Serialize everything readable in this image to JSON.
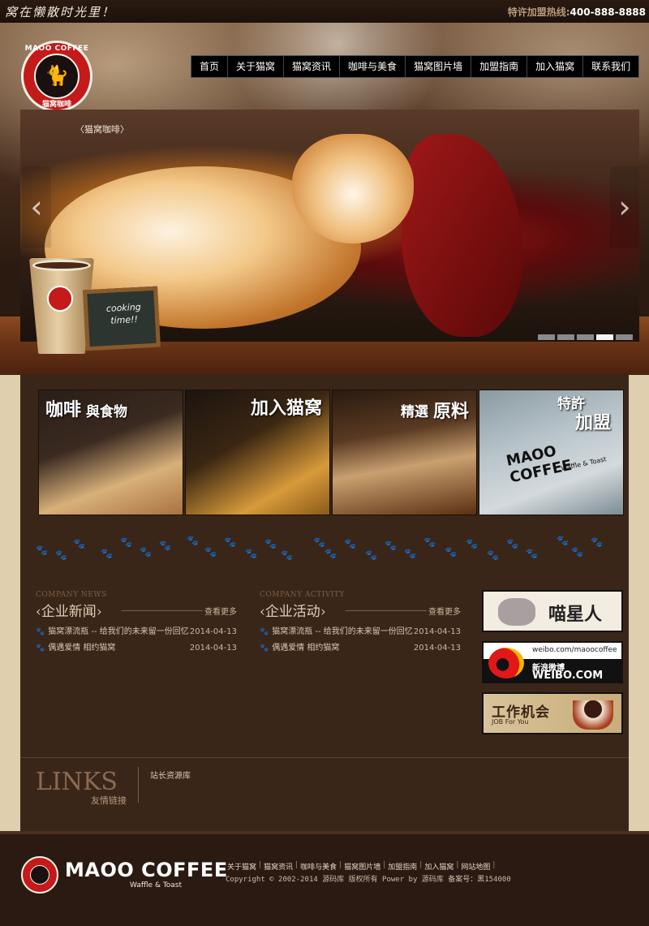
{
  "header": {
    "slogan": "窝在懒散时光里！",
    "hotline_label": "特许加盟热线:",
    "hotline_number": "400-888-8888"
  },
  "logo": {
    "top_text": "MAOO COFFEE",
    "bottom_text": "猫窝咖啡",
    "icon": "cat-icon"
  },
  "nav": {
    "items": [
      {
        "label": "首页"
      },
      {
        "label": "关于猫窝"
      },
      {
        "label": "猫窝资讯"
      },
      {
        "label": "咖啡与美食"
      },
      {
        "label": "猫窝图片墙"
      },
      {
        "label": "加盟指南"
      },
      {
        "label": "加入猫窝"
      },
      {
        "label": "联系我们"
      }
    ]
  },
  "slider": {
    "caption": "〈猫窝咖啡〉",
    "prev_icon": "chevron-left-icon",
    "next_icon": "chevron-right-icon",
    "chalkboard_text": "cooking time!!",
    "slide_count": 5,
    "active_slide": 4
  },
  "features": [
    {
      "title": "咖啡",
      "title2": "與食物"
    },
    {
      "title": "加入猫窝"
    },
    {
      "title": "精選",
      "title2": "原料"
    },
    {
      "title": "特許",
      "title2": "加盟",
      "brand": "MAOO COFFEE",
      "brand_sub": "Waffle & Toast"
    }
  ],
  "news": {
    "company_news": {
      "en": "COMPANY NEWS",
      "cn": "企业新闻",
      "more": "查看更多",
      "items": [
        {
          "title": "猫窝漂流瓶 -- 给我们的未来留一份回忆",
          "date": "2014-04-13"
        },
        {
          "title": "偶遇爱情 相约猫窝",
          "date": "2014-04-13"
        }
      ]
    },
    "company_activity": {
      "en": "COMPANY ACTIVITY",
      "cn": "企业活动",
      "more": "查看更多",
      "items": [
        {
          "title": "猫窝漂流瓶 -- 给我们的未来留一份回忆",
          "date": "2014-04-13"
        },
        {
          "title": "偶遇爱情 相约猫窝",
          "date": "2014-04-13"
        }
      ]
    }
  },
  "side_banners": {
    "banner1": {
      "text": "喵星人"
    },
    "banner2": {
      "url": "weibo.com/maoocoffee",
      "cn": "新浪微博",
      "en": "WEIBO.COM"
    },
    "banner3": {
      "text": "工作机会",
      "sub": "JOB For You"
    }
  },
  "links": {
    "en": "LINKS",
    "cn": "友情链接",
    "items": [
      "站长资源库"
    ]
  },
  "footer": {
    "brand": "MAOO COFFEE",
    "brand_sub": "Waffle & Toast",
    "links": [
      "关于猫窝",
      "猫窝资讯",
      "咖啡与美食",
      "猫窝图片墙",
      "加盟指南",
      "加入猫窝",
      "网站地图"
    ],
    "copyright": "Copyright © 2002-2014 源码库 版权所有 Power by 源码库 备案号：黑154000"
  },
  "colors": {
    "brand_red": "#c41a1a",
    "background_brown": "#3a2619",
    "nav_black": "#000000"
  }
}
